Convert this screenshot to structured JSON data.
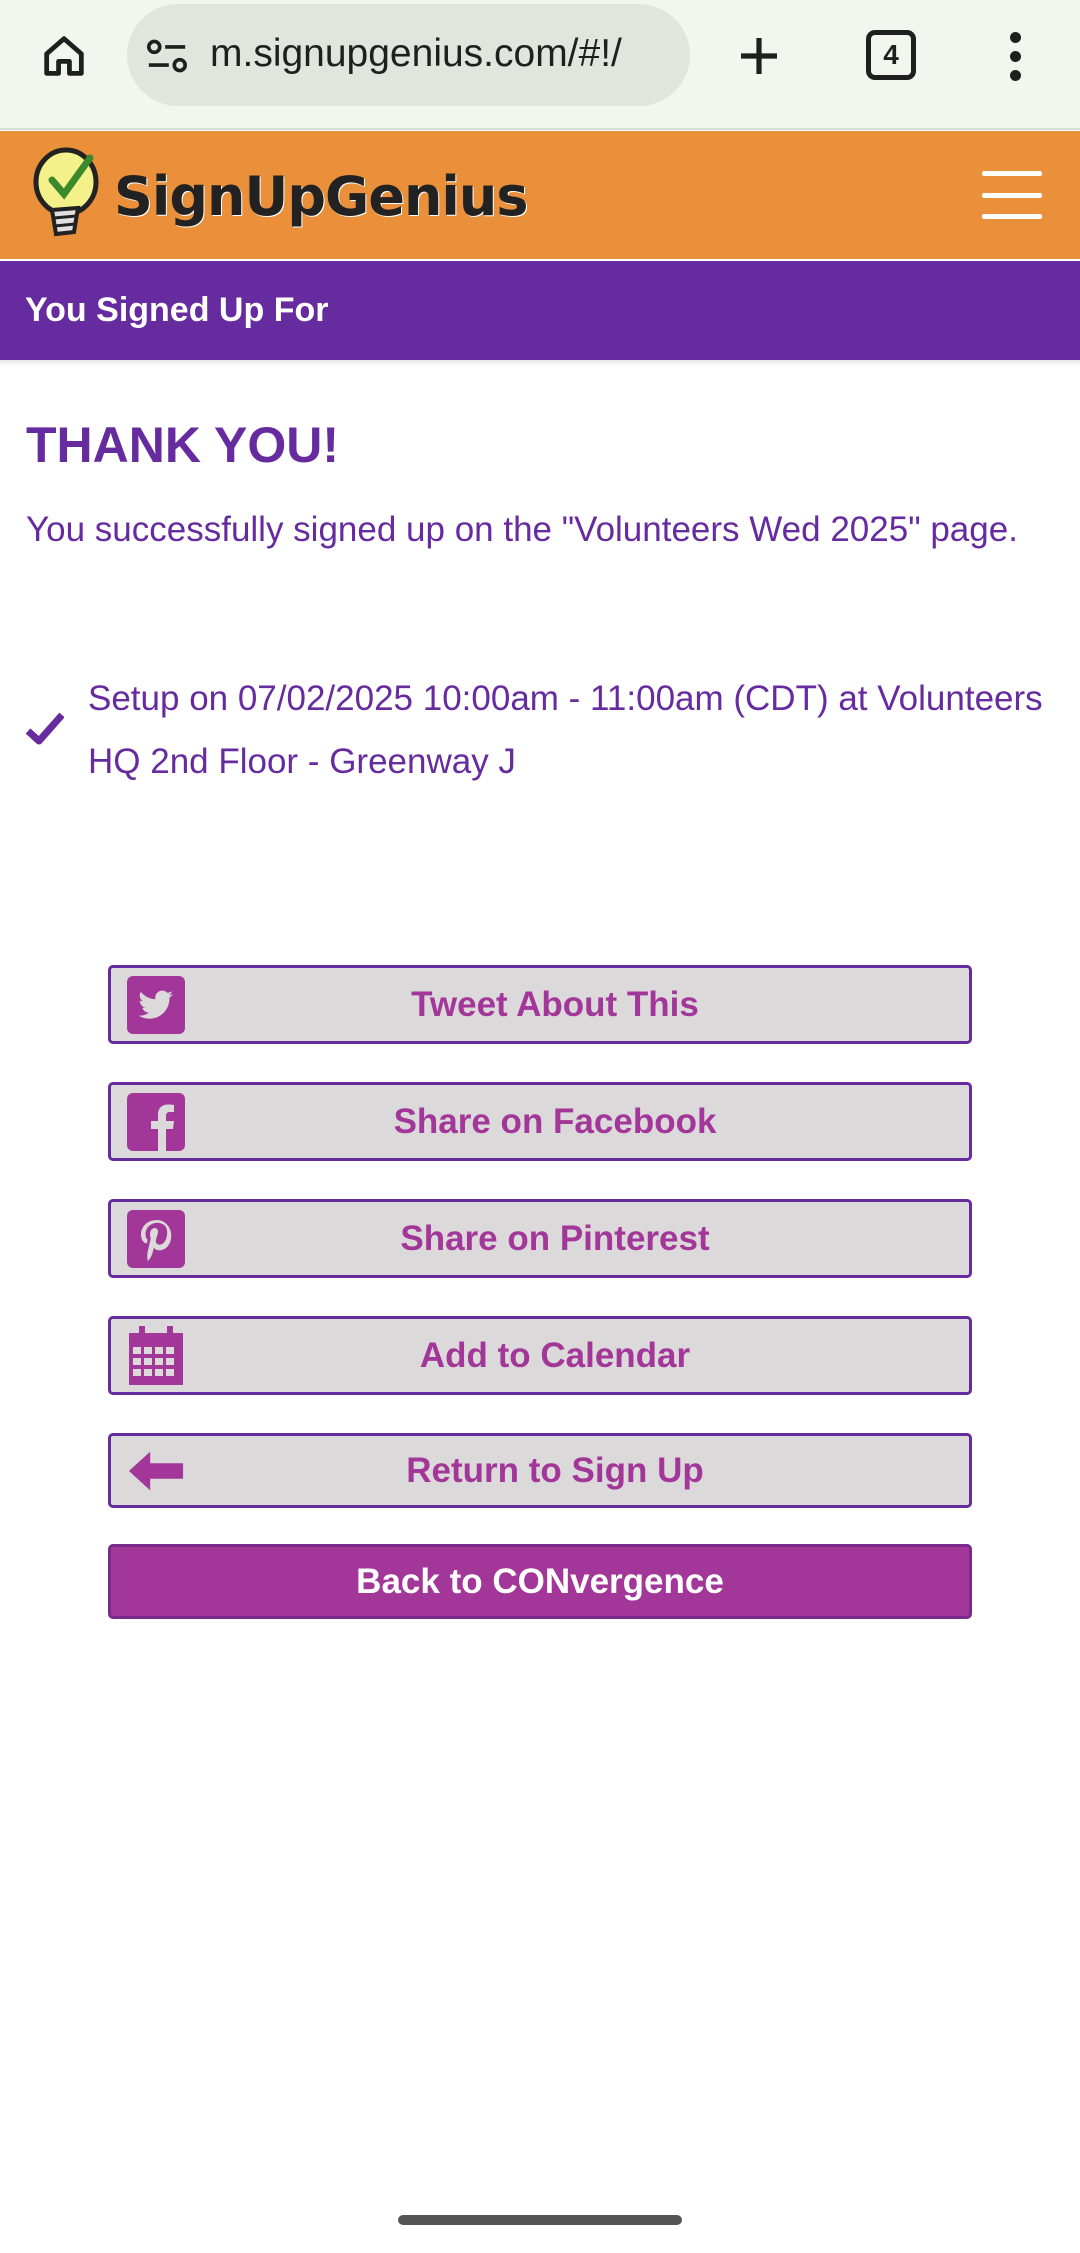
{
  "browser": {
    "url": "m.signupgenius.com/#!/",
    "tab_count": "4"
  },
  "site": {
    "logo_text": "SignUpGenius"
  },
  "title_bar": {
    "label": "You Signed Up For"
  },
  "confirmation": {
    "heading": "THANK YOU!",
    "message": "You successfully signed up on the \"Volunteers Wed 2025\" page.",
    "slots": [
      {
        "text": "Setup on 07/02/2025 10:00am - 11:00am (CDT) at Volunteers HQ 2nd Floor - Greenway J"
      }
    ]
  },
  "actions": {
    "tweet": "Tweet About This",
    "facebook": "Share on Facebook",
    "pinterest": "Share on Pinterest",
    "calendar": "Add to Calendar",
    "return": "Return to Sign Up",
    "back": "Back to CONvergence"
  },
  "colors": {
    "brand_orange": "#ea903a",
    "brand_purple": "#662b9e",
    "button_magenta": "#a23799",
    "button_bg": "#dcd9da"
  },
  "icons": [
    "home-icon",
    "site-info-icon",
    "plus-icon",
    "tabs-icon",
    "more-vert-icon",
    "hamburger-icon",
    "checkmark-icon",
    "twitter-icon",
    "facebook-icon",
    "pinterest-icon",
    "calendar-icon",
    "arrow-left-icon"
  ]
}
